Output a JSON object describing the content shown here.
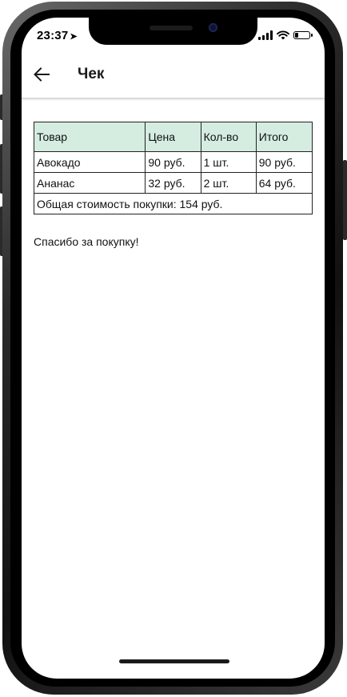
{
  "status_bar": {
    "time": "23:37",
    "location_glyph": "➤",
    "battery_level": 0.25
  },
  "app_bar": {
    "back_icon": "arrow-left",
    "title": "Чек"
  },
  "receipt": {
    "headers": [
      "Товар",
      "Цена",
      "Кол-во",
      "Итого"
    ],
    "rows": [
      [
        "Авокадо",
        "90 руб.",
        "1 шт.",
        "90 руб."
      ],
      [
        "Ананас",
        "32 руб.",
        "2 шт.",
        "64 руб."
      ]
    ],
    "total": "Общая стоимость покупки: 154 руб.",
    "header_color": "#d5ece1"
  },
  "message": "Спасибо за покупку!"
}
